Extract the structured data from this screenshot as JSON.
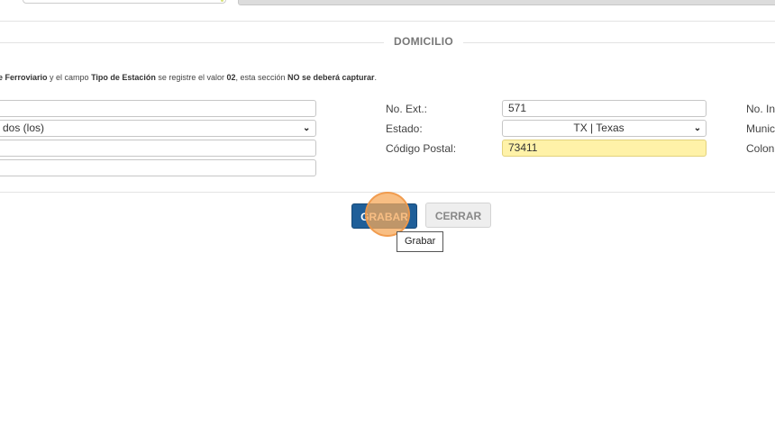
{
  "section": {
    "title": "DOMICILIO"
  },
  "notice": {
    "part1": "e Ferroviario",
    "part2": " y el campo ",
    "part3": "Tipo de Estación",
    "part4": " se registre el valor ",
    "part5": "02",
    "part6": ", esta sección ",
    "part7": "NO se deberá capturar",
    "part8": "."
  },
  "left_fields": {
    "row1_value": "",
    "row2_value": "dos (los)",
    "row3_value": "",
    "row4_value": ""
  },
  "middle": {
    "no_ext_label": "No. Ext.:",
    "no_ext_value": "571",
    "estado_label": "Estado:",
    "estado_value": "TX | Texas",
    "cp_label": "Código Postal:",
    "cp_value": "73411"
  },
  "right_cut": {
    "label1": "No. In",
    "label2": "Munic",
    "label3": "Colon"
  },
  "buttons": {
    "save_label": "GRABAR",
    "close_label": "CERRAR"
  },
  "tooltip": {
    "text": "Grabar"
  }
}
